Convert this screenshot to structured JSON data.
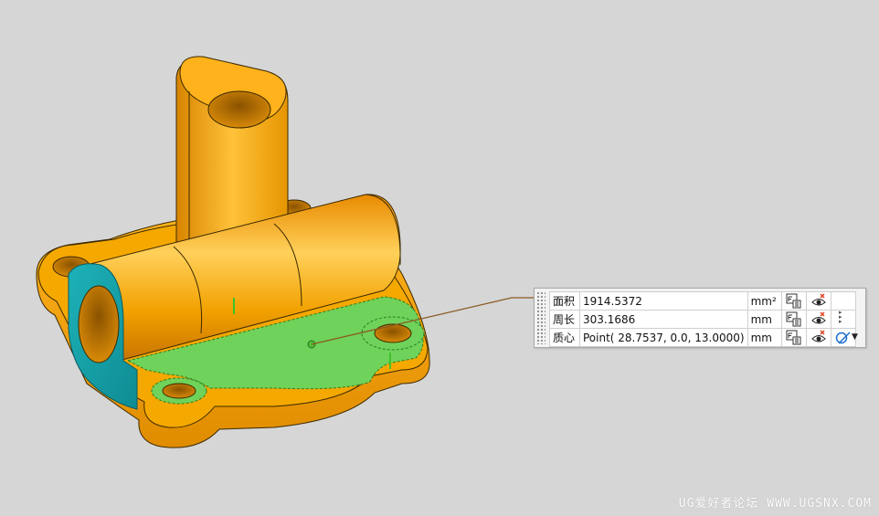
{
  "measurement": {
    "rows": [
      {
        "label": "面积",
        "value": "1914.5372",
        "unit": "mm²"
      },
      {
        "label": "周长",
        "value": "303.1686",
        "unit": "mm"
      },
      {
        "label": "质心",
        "value": "Point( 28.7537, 0.0, 13.0000)",
        "unit": "mm"
      }
    ]
  },
  "watermark": "UG爱好者论坛 WWW.UGSNX.COM",
  "colors": {
    "background": "#d6d6d6",
    "part_body": "#f0a000",
    "section_face": "#6fd25a",
    "cut_face": "#1aa5ad",
    "leader_line": "#8a5a22"
  },
  "icons": {
    "value_to_expression": "fx-expression-icon",
    "display_toggle": "eye-visibility-icon",
    "point_tool": "point-circle-icon"
  }
}
